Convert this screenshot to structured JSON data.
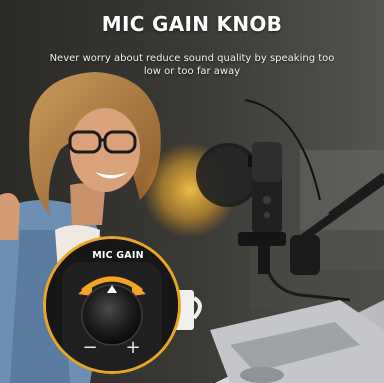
{
  "title": "MIC GAIN KNOB",
  "subtitle": "Never worry about reduce sound quality by speaking too low or too far away",
  "knob": {
    "label": "MIC GAIN",
    "minus_symbol": "−",
    "plus_symbol": "+"
  }
}
